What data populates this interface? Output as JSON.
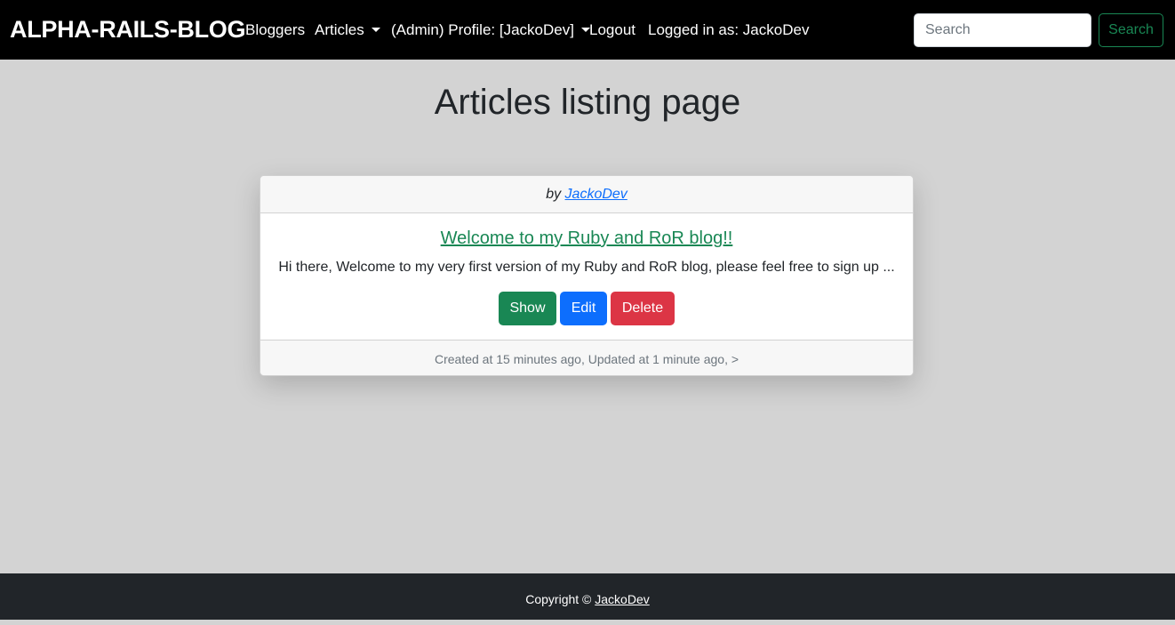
{
  "navbar": {
    "brand": "ALPHA-RAILS-BLOG",
    "links": {
      "bloggers": "Bloggers",
      "articles": "Articles",
      "profile": "(Admin) Profile: [JackoDev]",
      "logout": "Logout",
      "logged_in": "Logged in as: JackoDev"
    },
    "search": {
      "placeholder": "Search",
      "button": "Search"
    }
  },
  "page": {
    "title": "Articles listing page"
  },
  "articles": [
    {
      "by_label": "by",
      "author": "JackoDev",
      "title": "Welcome to my Ruby and RoR blog!!",
      "excerpt": "Hi there, Welcome to my very first version of my Ruby and RoR blog, please feel free to sign up ...",
      "buttons": {
        "show": "Show",
        "edit": "Edit",
        "delete": "Delete"
      },
      "meta": "Created at 15 minutes ago, Updated at 1 minute ago, >"
    }
  ],
  "footer": {
    "copyright": "Copyright ©",
    "author": "JackoDev"
  },
  "colors": {
    "background": "#d3d3d3",
    "navbar": "#000000",
    "footer": "#212529",
    "show": "#198754",
    "edit": "#0d6efd",
    "delete": "#dc3545"
  }
}
